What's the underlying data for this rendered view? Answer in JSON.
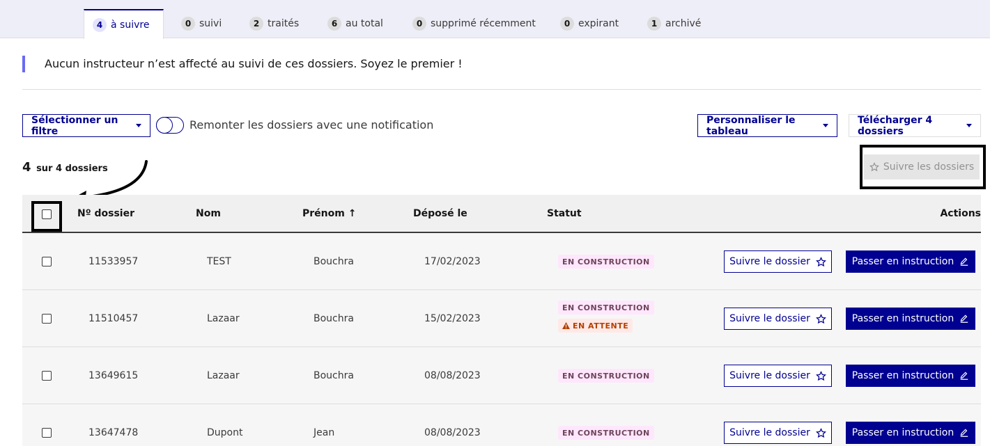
{
  "tabs": [
    {
      "count": "4",
      "label": "à suivre",
      "active": true
    },
    {
      "count": "0",
      "label": "suivi"
    },
    {
      "count": "2",
      "label": "traités"
    },
    {
      "count": "6",
      "label": "au total"
    },
    {
      "count": "0",
      "label": "supprimé récemment"
    },
    {
      "count": "0",
      "label": "expirant"
    },
    {
      "count": "1",
      "label": "archivé"
    }
  ],
  "notice": "Aucun instructeur n’est affecté au suivi de ces dossiers. Soyez le premier !",
  "toolbar": {
    "filter_label": "Sélectionner un filtre",
    "toggle_label": "Remonter les dossiers avec une notification",
    "customize_label": "Personnaliser le tableau",
    "download_label": "Télécharger 4 dossiers",
    "follow_all_label": "Suivre les dossiers"
  },
  "summary": {
    "count": "4",
    "text": "sur 4 dossiers"
  },
  "table": {
    "headers": {
      "number": "Nº dossier",
      "name": "Nom",
      "firstname": "Prénom ↑",
      "date": "Déposé le",
      "status": "Statut",
      "actions": "Actions"
    },
    "rows": [
      {
        "number": "11533957",
        "name": "TEST",
        "firstname": "Bouchra",
        "date": "17/02/2023",
        "status": "EN CONSTRUCTION",
        "status2": ""
      },
      {
        "number": "11510457",
        "name": "Lazaar",
        "firstname": "Bouchra",
        "date": "15/02/2023",
        "status": "EN CONSTRUCTION",
        "status2": "EN ATTENTE"
      },
      {
        "number": "13649615",
        "name": "Lazaar",
        "firstname": "Bouchra",
        "date": "08/08/2023",
        "status": "EN CONSTRUCTION",
        "status2": ""
      },
      {
        "number": "13647478",
        "name": "Dupont",
        "firstname": "Jean",
        "date": "08/08/2023",
        "status": "EN CONSTRUCTION",
        "status2": ""
      }
    ],
    "follow_label": "Suivre le dossier",
    "instruct_label": "Passer en instruction"
  },
  "colors": {
    "primary": "#000091",
    "accent": "#6a6af4",
    "badge_construct": "#fee7fc",
    "badge_wait": "#ffe9e6"
  }
}
